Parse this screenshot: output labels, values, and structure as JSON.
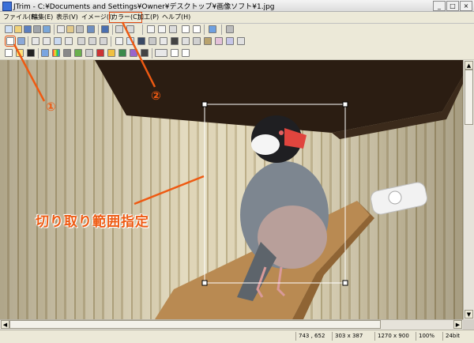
{
  "window": {
    "title": "JTrim - C:¥Documents and Settings¥Owner¥デスクトップ¥画像ソフト¥1.jpg",
    "minimize_glyph": "_",
    "maximize_glyph": "□",
    "close_glyph": "×"
  },
  "menu": [
    {
      "label": "ファイル(F)"
    },
    {
      "label": "編集(E)"
    },
    {
      "label": "表示(V)"
    },
    {
      "label": "イメージ(I)"
    },
    {
      "label": "カラー(C)",
      "highlighted": true
    },
    {
      "label": "加工(P)"
    },
    {
      "label": "ヘルプ(H)"
    }
  ],
  "toolbar_icons": {
    "row1": [
      "new-file-icon",
      "open-folder-icon",
      "save-icon",
      "print-icon",
      "scan-icon",
      "copy-icon",
      "paste-icon",
      "undo-icon",
      "redo-icon",
      "resize-icon",
      "text-icon",
      "rotate-icon",
      "grid-icon",
      "crop-view-icon",
      "eyedropper-icon",
      "frame-icon"
    ],
    "row2": [
      "crop-tool-icon",
      "trim-icon",
      "flip-horizontal-icon",
      "flip-vertical-icon",
      "mirror-icon",
      "invert-icon",
      "rotate-left-icon",
      "rotate-right-icon",
      "rotate-free-icon",
      "layer-icon",
      "border-icon",
      "shadow-icon",
      "mosaic-icon",
      "blur-icon",
      "sharpen-icon",
      "noise-icon",
      "emboss-icon",
      "sepia-icon",
      "filter-icon",
      "special-icon"
    ],
    "row3": [
      "brightness-icon",
      "contrast-icon",
      "palette-icon",
      "color-balance-icon",
      "grayscale-icon",
      "gamma-icon",
      "hue-icon",
      "rgb-icon",
      "channel-icon",
      "gradient-icon",
      "wave-icon",
      "zoom-select-icon",
      "zoom-in-icon",
      "zoom-out-icon"
    ]
  },
  "annotations": {
    "marker1": "①",
    "marker2": "②",
    "caption": "切り取り範囲指定"
  },
  "status": {
    "cursor": "743 , 652",
    "selection": "303 x 387",
    "image_size": "1270 x 900",
    "zoom": "100%",
    "bit_depth": "24bit"
  },
  "colors": {
    "accent": "#ee5a12"
  }
}
